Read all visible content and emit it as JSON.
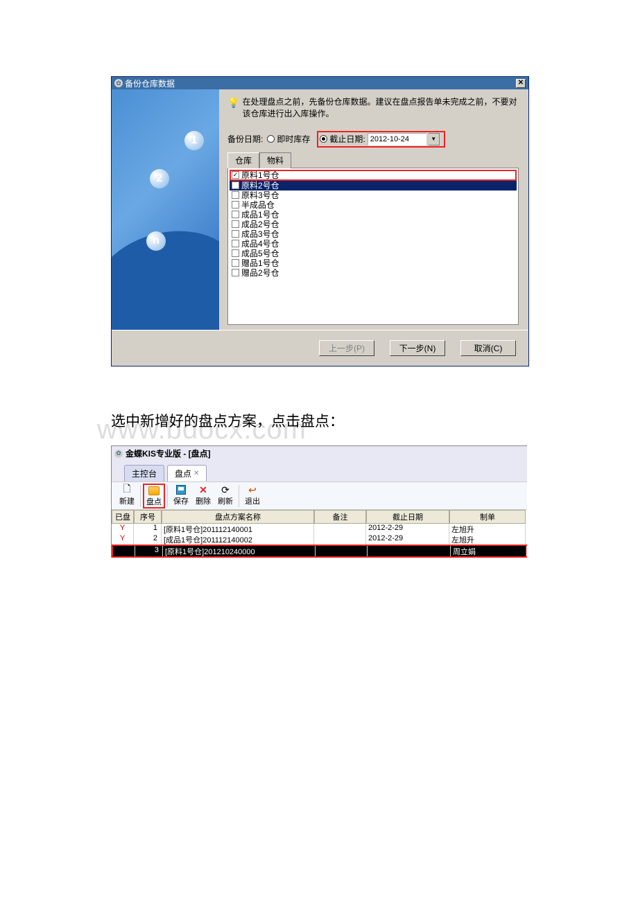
{
  "dialog1": {
    "title": "备份仓库数据",
    "hint": "在处理盘点之前，先备份仓库数据。建议在盘点报告单未完成之前，不要对该仓库进行出入库操作。",
    "backup_label": "备份日期:",
    "radio_now": "即时库存",
    "radio_until": "截止日期:",
    "date_value": "2012-10-24",
    "tab_warehouse": "仓库",
    "tab_material": "物料",
    "warehouses": [
      {
        "label": "原料1号仓",
        "checked": true,
        "highlighted": true,
        "selected": false
      },
      {
        "label": "原料2号仓",
        "checked": false,
        "highlighted": false,
        "selected": true
      },
      {
        "label": "原料3号仓",
        "checked": false,
        "highlighted": false,
        "selected": false
      },
      {
        "label": "半成品仓",
        "checked": false,
        "highlighted": false,
        "selected": false
      },
      {
        "label": "成品1号仓",
        "checked": false,
        "highlighted": false,
        "selected": false
      },
      {
        "label": "成品2号仓",
        "checked": false,
        "highlighted": false,
        "selected": false
      },
      {
        "label": "成品3号仓",
        "checked": false,
        "highlighted": false,
        "selected": false
      },
      {
        "label": "成品4号仓",
        "checked": false,
        "highlighted": false,
        "selected": false
      },
      {
        "label": "成品5号仓",
        "checked": false,
        "highlighted": false,
        "selected": false
      },
      {
        "label": "赠品1号仓",
        "checked": false,
        "highlighted": false,
        "selected": false
      },
      {
        "label": "赠品2号仓",
        "checked": false,
        "highlighted": false,
        "selected": false
      }
    ],
    "btn_prev": "上一步(P)",
    "btn_next": "下一步(N)",
    "btn_cancel": "取消(C)"
  },
  "mid_paragraph": "选中新增好的盘点方案，点击盘点：",
  "watermark": "www.bdocx.com",
  "window2": {
    "app_title": "金蝶KIS专业版 - [盘点]",
    "tab_main": "主控台",
    "tab_pandian": "盘点",
    "toolbar": {
      "new": "新建",
      "pandian": "盘点",
      "save": "保存",
      "delete": "删除",
      "refresh": "刷新",
      "exit": "退出"
    },
    "headers": {
      "done": "已盘",
      "seq": "序号",
      "name": "盘点方案名称",
      "remark": "备注",
      "date": "截止日期",
      "maker": "制单"
    },
    "rows": [
      {
        "done": "Y",
        "seq": "1",
        "name": "[原料1号仓]201112140001",
        "remark": "",
        "date": "2012-2-29",
        "maker": "左旭升",
        "sel": false
      },
      {
        "done": "Y",
        "seq": "2",
        "name": "[成品1号仓]201112140002",
        "remark": "",
        "date": "2012-2-29",
        "maker": "左旭升",
        "sel": false
      },
      {
        "done": "",
        "seq": "3",
        "name": "[原料1号仓]201210240000",
        "remark": "",
        "date": "",
        "maker": "周立娟",
        "sel": true
      }
    ]
  }
}
